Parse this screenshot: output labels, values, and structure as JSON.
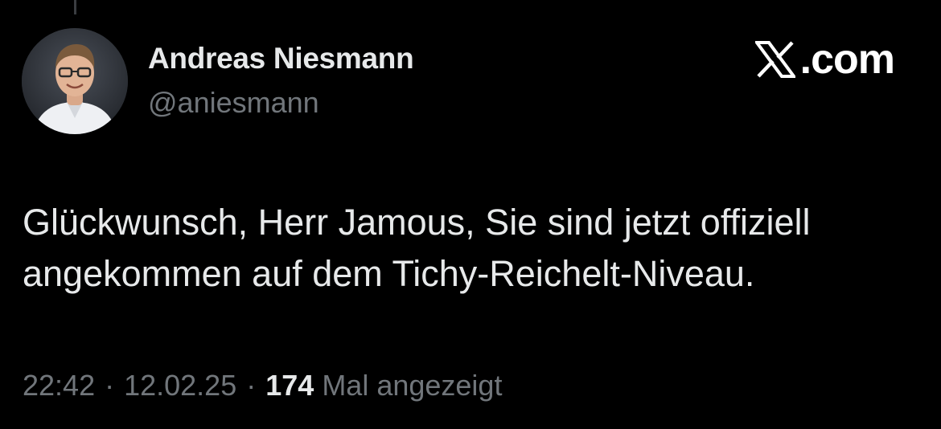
{
  "author": {
    "display_name": "Andreas Niesmann",
    "handle": "@aniesmann",
    "avatar_icon": "profile-photo"
  },
  "watermark": {
    "logo_icon": "x-logo-icon",
    "text": ".com"
  },
  "tweet": {
    "lines": [
      "Glückwunsch, Herr Jamous, Sie sind jetzt offiziell",
      "angekommen auf dem Tichy-Reichelt-Niveau."
    ]
  },
  "meta": {
    "time": "22:42",
    "separator": "·",
    "date": "12.02.25",
    "views_count": "174",
    "views_label": "Mal angezeigt"
  },
  "colors": {
    "background": "#000000",
    "primary_text": "#e7e9ea",
    "secondary_text": "#71767b"
  }
}
